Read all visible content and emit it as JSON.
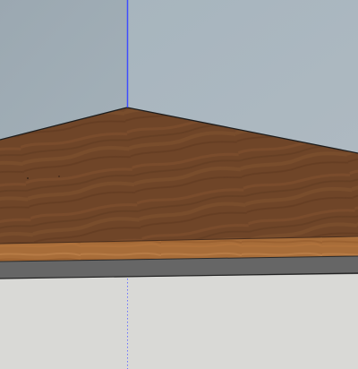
{
  "scene": {
    "type": "3d-modeling-viewport",
    "objects": [
      "back wall",
      "left wall",
      "wood floor",
      "floor edge",
      "ground plane"
    ],
    "axis_lines": [
      "vertical-blue-axis",
      "vertical-dotted-axis"
    ]
  },
  "colors": {
    "wall_left": "#9eabb3",
    "wall_right": "#a8b7c0",
    "floor_main": "#6b4327",
    "floor_edge": "#a56a36",
    "ground": "#d9d9d6",
    "shadow": "#666666",
    "axis_blue": "#3e4cff"
  },
  "icons": [
    "wood-texture-surface",
    "axis-line"
  ]
}
